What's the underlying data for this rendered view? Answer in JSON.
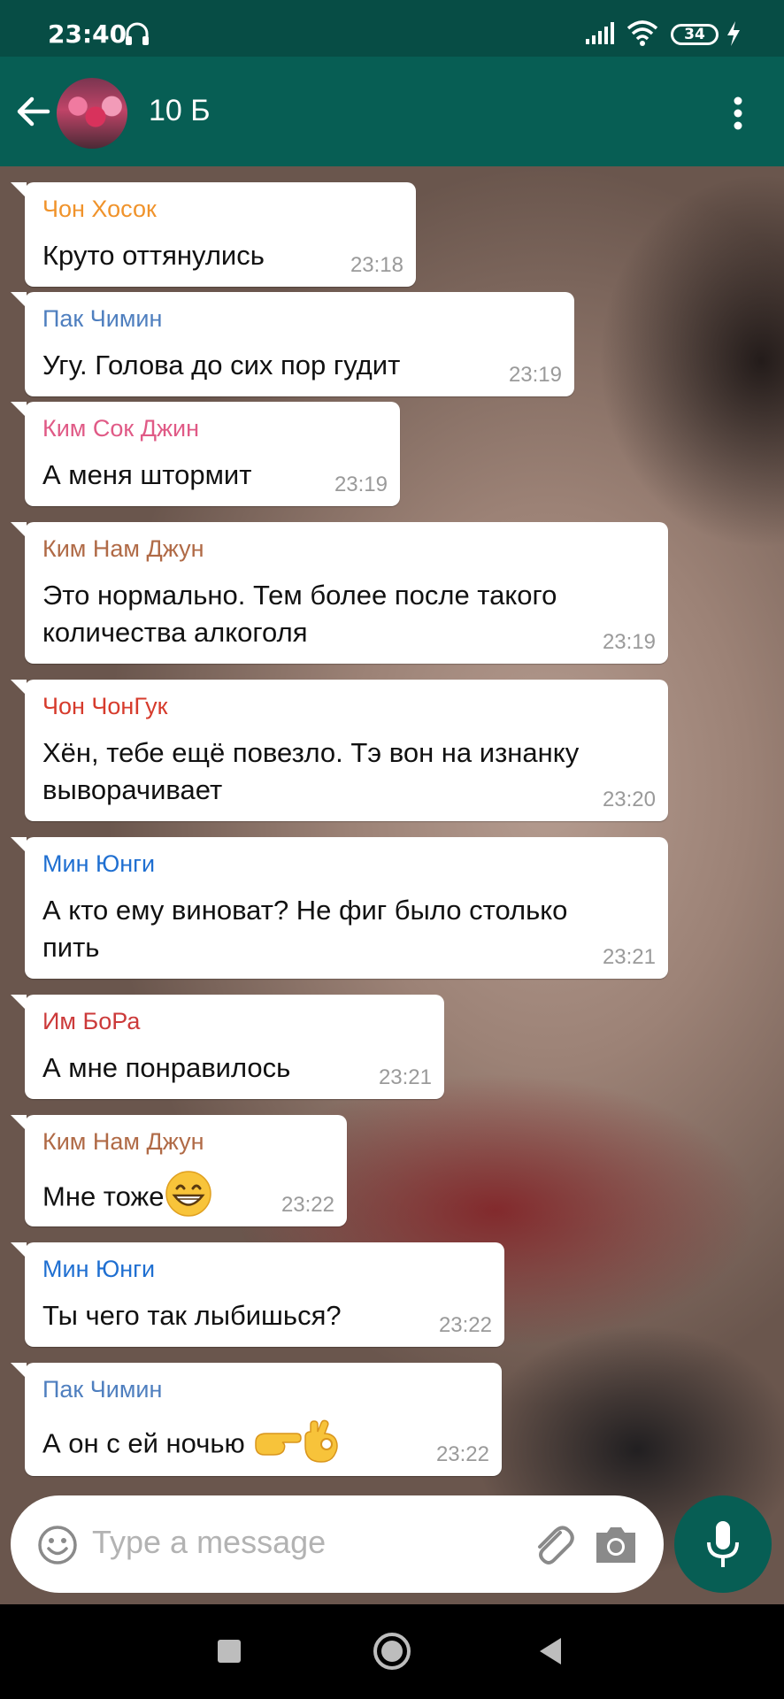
{
  "status_bar": {
    "time": "23:40",
    "battery": "34"
  },
  "header": {
    "title": "10 Б",
    "avatar_alt": "group-avatar"
  },
  "messages": [
    {
      "sender": "Чон Хосок",
      "sender_color": "#f0932b",
      "text": "Круто оттянулись",
      "time": "23:18"
    },
    {
      "sender": "Пак Чимин",
      "sender_color": "#4f7fbf",
      "text": "Угу. Голова до сих пор гудит",
      "time": "23:19"
    },
    {
      "sender": "Ким Сок Джин",
      "sender_color": "#e05a86",
      "text": "А меня штормит",
      "time": "23:19"
    },
    {
      "sender": "Ким Нам Джун",
      "sender_color": "#b06a46",
      "text_lines": [
        "Это нормально. Тем более после такого",
        "количества алкоголя"
      ],
      "time": "23:19"
    },
    {
      "sender": "Чон ЧонГук",
      "sender_color": "#d63b2c",
      "text_lines": [
        "Хён, тебе ещё повезло. Тэ вон на изнанку",
        "выворачивает"
      ],
      "time": "23:20"
    },
    {
      "sender": "Мин Юнги",
      "sender_color": "#1f6fd1",
      "text_lines": [
        "А кто ему виноват? Не фиг было столько",
        "пить"
      ],
      "time": "23:21"
    },
    {
      "sender": "Им БоРа",
      "sender_color": "#cc3a3a",
      "text": "А мне понравилось",
      "time": "23:21"
    },
    {
      "sender": "Ким Нам Джун",
      "sender_color": "#b06a46",
      "text": "Мне тоже",
      "emoji": "grinning-face",
      "time": "23:22"
    },
    {
      "sender": "Мин Юнги",
      "sender_color": "#1f6fd1",
      "text": "Ты чего так лыбишься?",
      "time": "23:22"
    },
    {
      "sender": "Пак Чимин",
      "sender_color": "#4f7fbf",
      "text": "А он с ей ночью",
      "emoji": "pointing-hand-ok-hand",
      "time": "23:22"
    }
  ],
  "input": {
    "placeholder": "Type a message"
  },
  "colors": {
    "header_bg": "#075e54",
    "status_bg": "#074d45",
    "mic_bg": "#075e54"
  }
}
